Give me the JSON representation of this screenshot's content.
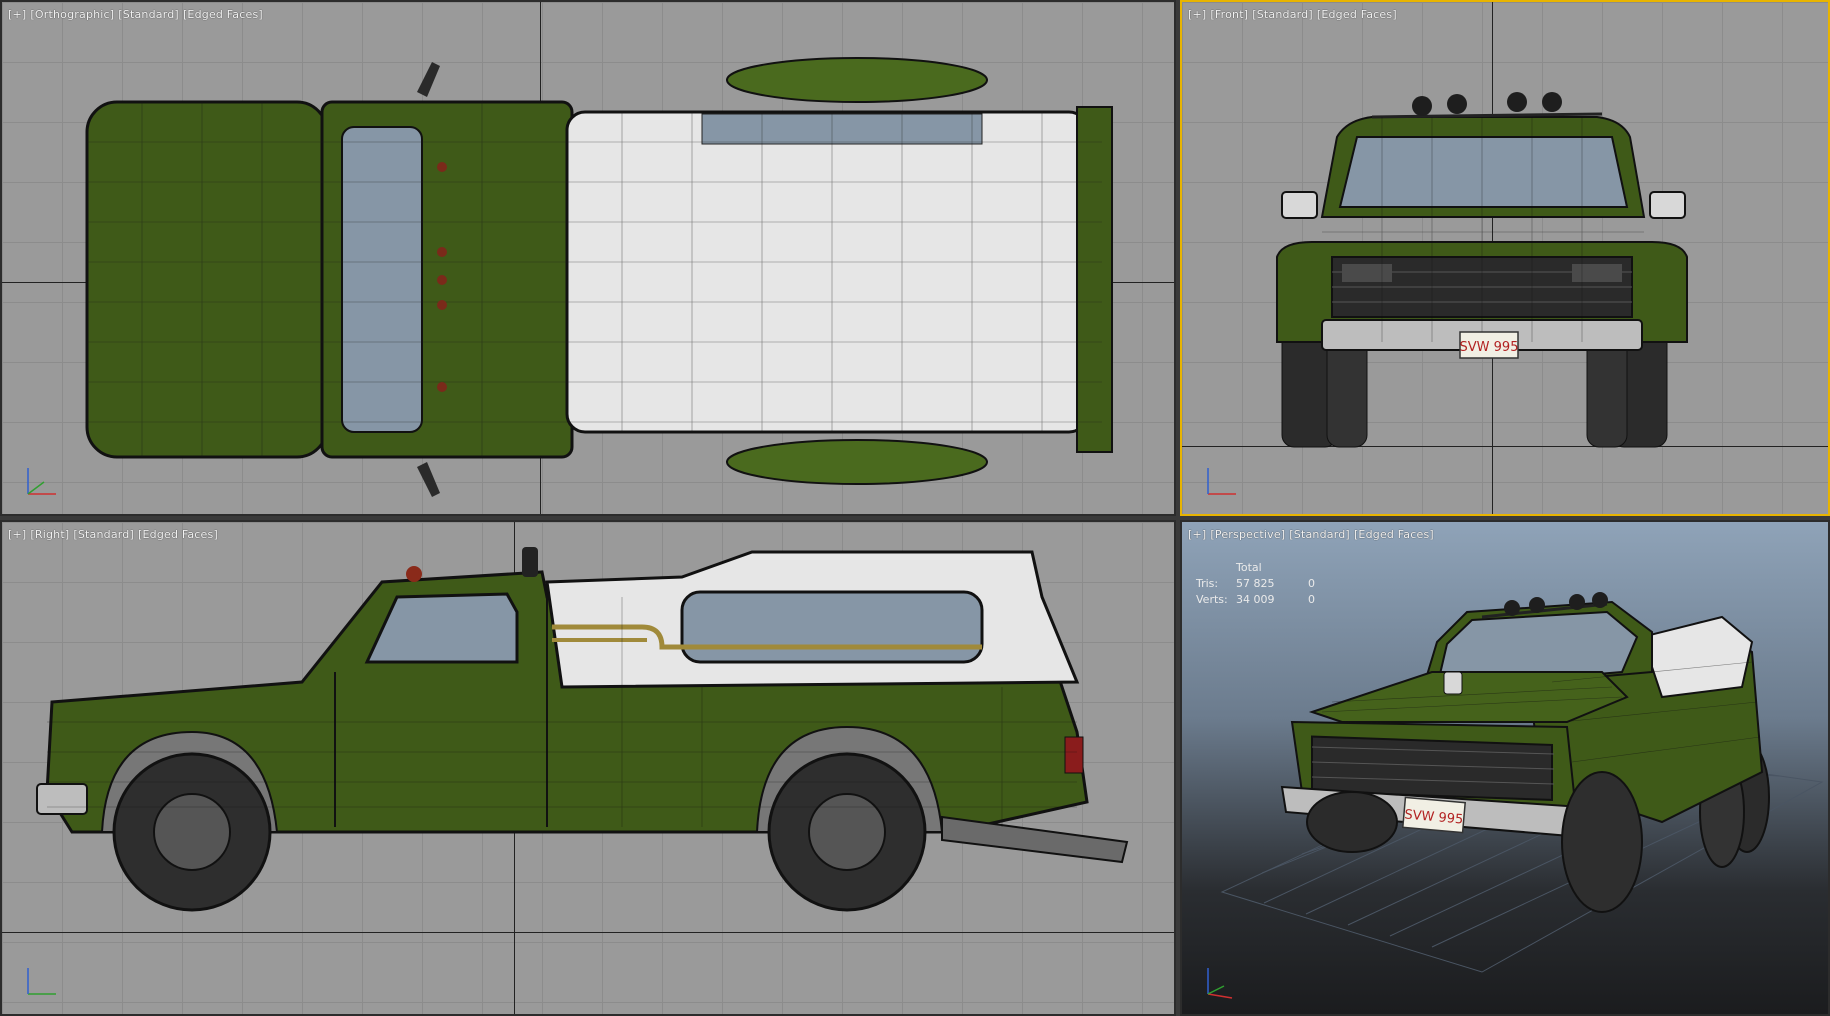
{
  "viewports": {
    "top": {
      "label": [
        "[+]",
        "[Orthographic]",
        "[Standard]",
        "[Edged Faces]"
      ]
    },
    "front": {
      "label": [
        "[+]",
        "[Front]",
        "[Standard]",
        "[Edged Faces]"
      ]
    },
    "right": {
      "label": [
        "[+]",
        "[Right]",
        "[Standard]",
        "[Edged Faces]"
      ]
    },
    "perspective": {
      "label": [
        "[+]",
        "[Perspective]",
        "[Standard]",
        "[Edged Faces]"
      ],
      "stats": {
        "header": "Total",
        "tris_label": "Tris:",
        "tris_total": "57 825",
        "tris_selected": "0",
        "verts_label": "Verts:",
        "verts_total": "34 009",
        "verts_selected": "0"
      }
    }
  },
  "license_plate": "SVW 995",
  "colors": {
    "body_green": "#3f5a18",
    "canopy_white": "#e6e6e6",
    "glass": "#8696a6",
    "stripe_gold": "#a08a3a",
    "active_border": "#e8b400"
  },
  "gizmo_axes": [
    "x",
    "y",
    "z"
  ]
}
